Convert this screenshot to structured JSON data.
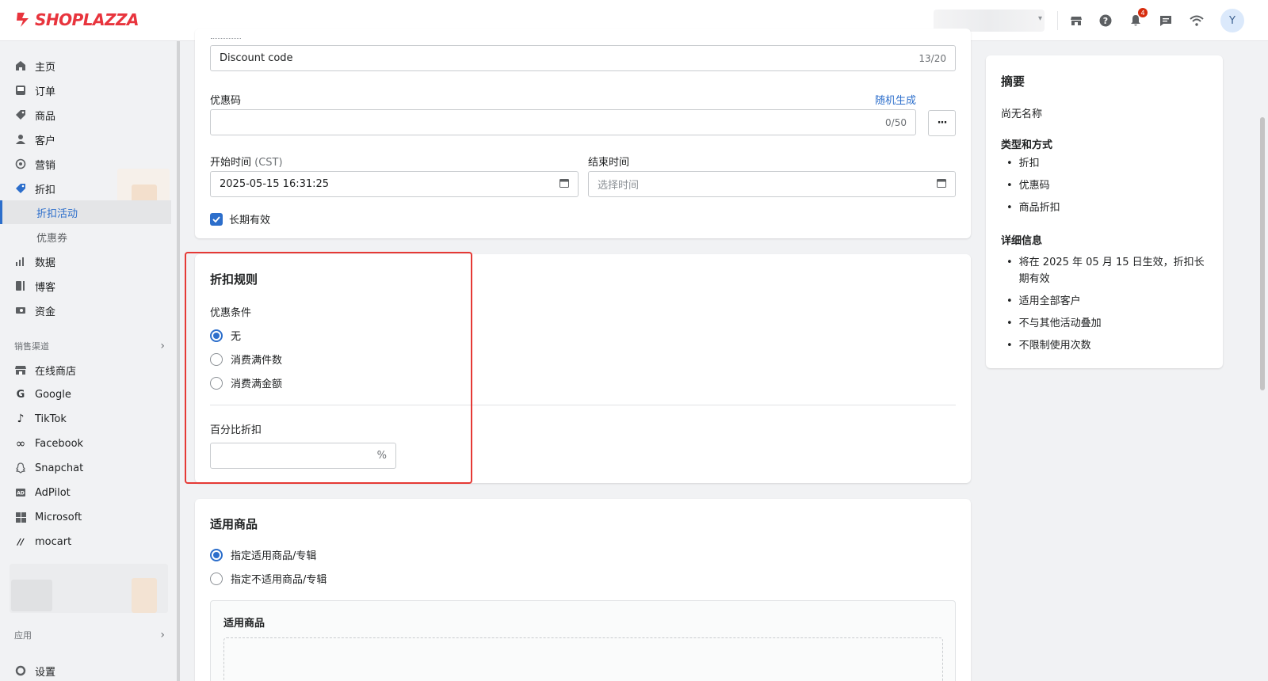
{
  "topbar": {
    "brand": "SHOPLAZZA",
    "notification_count": "4",
    "avatar_initial": "Y",
    "brand_color": "#e8343d"
  },
  "sidebar": {
    "items": [
      {
        "label": "主页",
        "icon": "home-icon"
      },
      {
        "label": "订单",
        "icon": "inbox-icon"
      },
      {
        "label": "商品",
        "icon": "tag-icon"
      },
      {
        "label": "客户",
        "icon": "person-icon"
      },
      {
        "label": "营销",
        "icon": "target-icon"
      },
      {
        "label": "折扣",
        "icon": "discount-icon"
      }
    ],
    "discount_sub": [
      "折扣活动",
      "优惠券"
    ],
    "items2": [
      {
        "label": "数据",
        "icon": "bar-chart-icon"
      },
      {
        "label": "博客",
        "icon": "blog-icon"
      },
      {
        "label": "资金",
        "icon": "money-icon"
      }
    ],
    "channels_title": "销售渠道",
    "channels": [
      {
        "label": "在线商店",
        "icon": "store-icon"
      },
      {
        "label": "Google",
        "icon": "google-icon"
      },
      {
        "label": "TikTok",
        "icon": "tiktok-icon"
      },
      {
        "label": "Facebook",
        "icon": "meta-icon"
      },
      {
        "label": "Snapchat",
        "icon": "ghost-icon"
      },
      {
        "label": "AdPilot",
        "icon": "ad-icon"
      },
      {
        "label": "Microsoft",
        "icon": "windows-icon"
      },
      {
        "label": "mocart",
        "icon": "mocart-icon"
      }
    ],
    "apps_title": "应用",
    "settings_label": "设置"
  },
  "form": {
    "title_value": "Discount code",
    "title_counter": "13/20",
    "code_label": "优惠码",
    "random_link": "随机生成",
    "code_counter": "0/50",
    "start_label": "开始时间",
    "start_tz": "(CST)",
    "start_value": "2025-05-15 16:31:25",
    "end_label": "结束时间",
    "end_placeholder": "选择时间",
    "long_term_label": "长期有效"
  },
  "rules": {
    "title": "折扣规则",
    "condition_label": "优惠条件",
    "options": [
      "无",
      "消费满件数",
      "消费满金额"
    ],
    "percent_label": "百分比折扣",
    "percent_suffix": "%"
  },
  "products": {
    "title": "适用商品",
    "options": [
      "指定适用商品/专辑",
      "指定不适用商品/专辑"
    ],
    "sub_title": "适用商品"
  },
  "summary": {
    "title": "摘要",
    "no_name": "尚无名称",
    "type_title": "类型和方式",
    "type_items": [
      "折扣",
      "优惠码",
      "商品折扣"
    ],
    "detail_title": "详细信息",
    "detail_items": [
      "将在 2025 年 05 月 15 日生效，折扣长期有效",
      "适用全部客户",
      "不与其他活动叠加",
      "不限制使用次数"
    ]
  }
}
